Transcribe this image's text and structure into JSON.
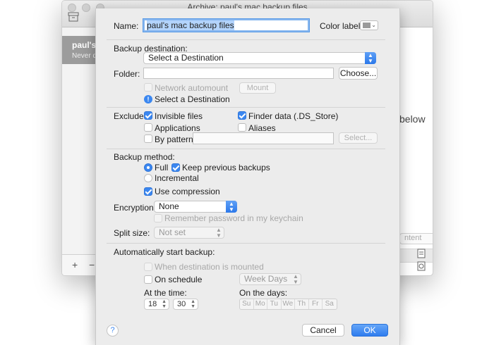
{
  "window": {
    "title": "Archive: paul's mac backup files",
    "sidebar_item_name": "paul's mac backup files",
    "sidebar_item_sub": "Never done",
    "below_text": "below",
    "content_button": "ntent"
  },
  "form": {
    "name_label": "Name:",
    "name_value": "paul's mac backup files",
    "color_label": "Color label:",
    "backup_destination_label": "Backup destination:",
    "destination_popup": "Select a Destination",
    "folder_label": "Folder:",
    "folder_value": "",
    "choose_button": "Choose...",
    "network_automount": "Network automount",
    "mount_button": "Mount",
    "destination_info": "Select a Destination",
    "exclude_label": "Exclude:",
    "invisible_files": "Invisible files",
    "finder_data": "Finder data (.DS_Store)",
    "applications": "Applications",
    "aliases": "Aliases",
    "by_pattern": "By pattern:",
    "pattern_value": "",
    "select_button": "Select...",
    "backup_method_label": "Backup method:",
    "full": "Full",
    "keep_previous": "Keep previous backups",
    "incremental": "Incremental",
    "use_compression": "Use compression",
    "encryption_label": "Encryption:",
    "encryption_value": "None",
    "remember_password": "Remember password in my keychain",
    "split_size_label": "Split size:",
    "split_size_value": "Not set",
    "auto_start_label": "Automatically start backup:",
    "when_mounted": "When destination is mounted",
    "on_schedule": "On schedule",
    "schedule_value": "Week Days",
    "at_time_label": "At the time:",
    "hour": "18",
    "minute": "30",
    "on_days_label": "On the days:",
    "days": [
      "Su",
      "Mo",
      "Tu",
      "We",
      "Th",
      "Fr",
      "Sa"
    ],
    "help": "?",
    "cancel_button": "Cancel",
    "ok_button": "OK"
  },
  "state": {
    "invisible_files": true,
    "finder_data": true,
    "applications": false,
    "aliases": false,
    "by_pattern": false,
    "method": "Full",
    "keep_previous": true,
    "use_compression": true,
    "on_schedule": false
  },
  "colors": {
    "accent": "#3b87f0",
    "sheet_bg": "#ececec",
    "color_label_swatch": "#9a9a9a"
  }
}
